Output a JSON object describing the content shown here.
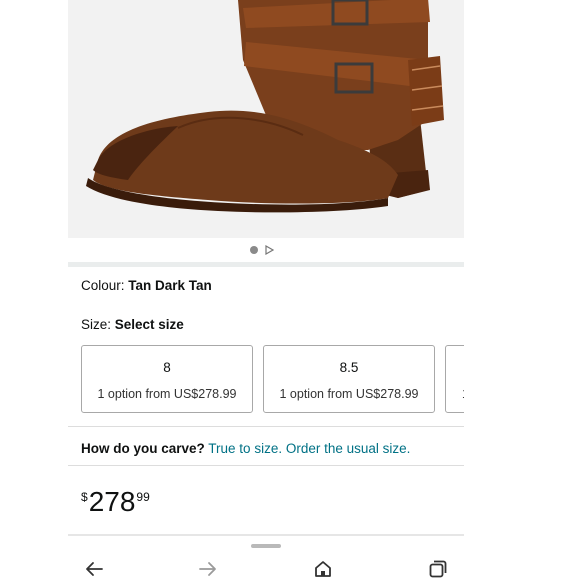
{
  "product": {
    "colour_label": "Colour: ",
    "colour_value": "Tan Dark Tan",
    "size_label": "Size: ",
    "size_value": "Select size"
  },
  "sizes": [
    {
      "size": "8",
      "option": "1 option from US$278.99"
    },
    {
      "size": "8.5",
      "option": "1 option from US$278.99"
    },
    {
      "size": "",
      "option": "1"
    }
  ],
  "fit": {
    "question": "How do you carve?",
    "answer": "True to size. Order the usual size."
  },
  "price": {
    "currency": "$",
    "whole": "278",
    "fraction": "99"
  },
  "icons": {
    "carousel_play": "play-icon",
    "back": "arrow-left-icon",
    "forward": "arrow-right-icon",
    "home": "home-icon",
    "tabs": "tabs-icon"
  },
  "colors": {
    "link": "#007185",
    "text": "#0f1111",
    "border": "#a8a8a8"
  }
}
